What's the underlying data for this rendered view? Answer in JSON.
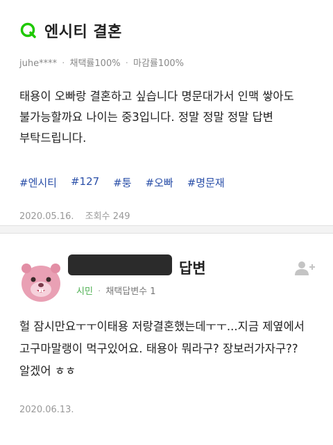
{
  "question": {
    "title": "엔시티 결혼",
    "icon": "green-q-icon",
    "author": "juhe****",
    "adopt_rate": "채택률100%",
    "deadline_rate": "마감률100%",
    "body": "태용이 오빠랑 결혼하고 싶습니다 명문대가서 인맥 쌓아도 불가능할까요 나이는 중3입니다. 정말 정말 정말 답변 부탁드립니다.",
    "tags": [
      "#엔시티",
      "#127",
      "#퉁",
      "#오빠",
      "#명문재"
    ],
    "date": "2020.05.16.",
    "views": "조회수 249"
  },
  "answer": {
    "title_suffix": "답변",
    "grade": "시민",
    "adopted_count": "채택답변수 1",
    "body": "헐 잠시만요ㅜㅜ이태용 저랑결혼했는데ㅜㅜ...지금 제옆에서 고구마말랭이 먹구있어요. 태용아 뭐라구? 장보러가자구??알겠어 ㅎㅎ",
    "date": "2020.06.13."
  },
  "colors": {
    "accent_green": "#1ec800",
    "tag_blue": "#2a4fa8",
    "grade_green": "#4caf50"
  }
}
